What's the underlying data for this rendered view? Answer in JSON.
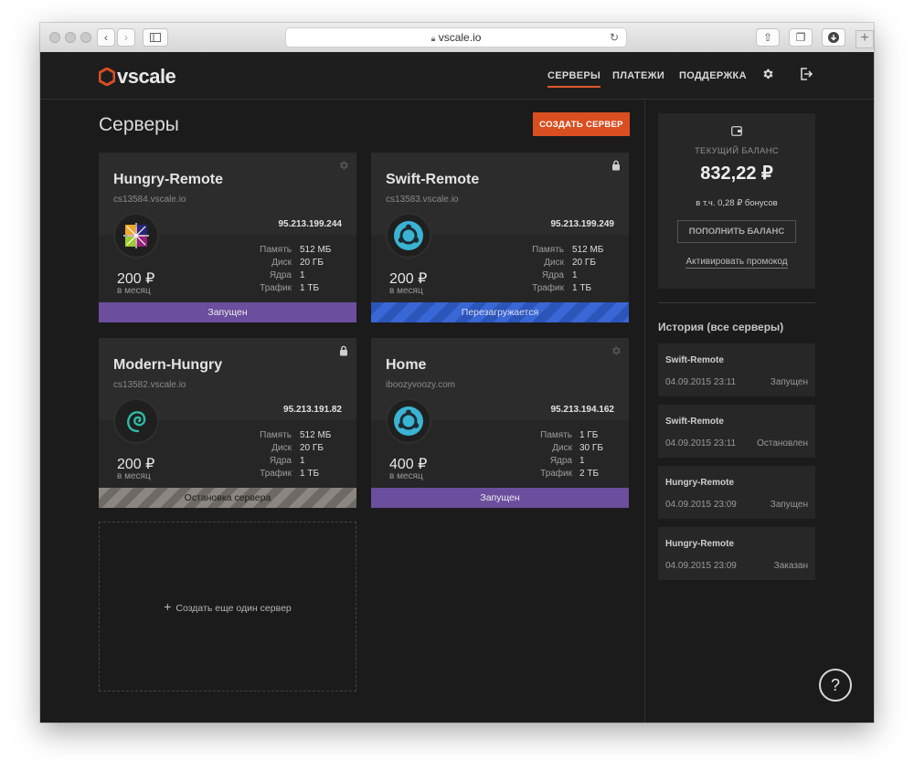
{
  "browser": {
    "url": "vscale.io"
  },
  "header": {
    "logo": "vscale",
    "nav": [
      {
        "label": "СЕРВЕРЫ"
      },
      {
        "label": "ПЛАТЕЖИ"
      },
      {
        "label": "ПОДДЕРЖКА"
      }
    ]
  },
  "main": {
    "title": "Серверы",
    "create_label": "СОЗДАТЬ СЕРВЕР",
    "new_server_label": "Создать еще один сервер",
    "spec_labels": {
      "memory": "Память",
      "disk": "Диск",
      "cores": "Ядра",
      "traffic": "Трафик"
    },
    "per_month": "в месяц",
    "servers": [
      {
        "name": "Hungry-Remote",
        "host": "cs13584.vscale.io",
        "ip": "95.213.199.244",
        "os": "centos-icon",
        "price": "200 ₽",
        "memory": "512 МБ",
        "disk": "20 ГБ",
        "cores": "1",
        "traffic": "1 ТБ",
        "status": "Запущен",
        "corner_icon": "gear-icon"
      },
      {
        "name": "Swift-Remote",
        "host": "cs13583.vscale.io",
        "ip": "95.213.199.249",
        "os": "ubuntu-icon",
        "price": "200 ₽",
        "memory": "512 МБ",
        "disk": "20 ГБ",
        "cores": "1",
        "traffic": "1 ТБ",
        "status": "Перезагружается",
        "corner_icon": "lock-icon"
      },
      {
        "name": "Modern-Hungry",
        "host": "cs13582.vscale.io",
        "ip": "95.213.191.82",
        "os": "debian-icon",
        "price": "200 ₽",
        "memory": "512 МБ",
        "disk": "20 ГБ",
        "cores": "1",
        "traffic": "1 ТБ",
        "status": "Остановка сервера",
        "corner_icon": "lock-icon"
      },
      {
        "name": "Home",
        "host": "iboozyvoozy.com",
        "ip": "95.213.194.162",
        "os": "ubuntu-icon",
        "price": "400 ₽",
        "memory": "1 ГБ",
        "disk": "30 ГБ",
        "cores": "1",
        "traffic": "2 ТБ",
        "status": "Запущен",
        "corner_icon": "gear-icon"
      }
    ]
  },
  "sidebar": {
    "balance_label": "ТЕКУЩИЙ БАЛАНС",
    "balance": "832,22 ₽",
    "bonus": "в т.ч. 0,28 ₽ бонусов",
    "topup_label": "ПОПОЛНИТЬ БАЛАНС",
    "promo_label": "Активировать промокод",
    "history_title": "История (все серверы)",
    "history": [
      {
        "server": "Swift-Remote",
        "date": "04.09.2015 23:11",
        "status": "Запущен"
      },
      {
        "server": "Swift-Remote",
        "date": "04.09.2015 23:11",
        "status": "Остановлен"
      },
      {
        "server": "Hungry-Remote",
        "date": "04.09.2015 23:09",
        "status": "Запущен"
      },
      {
        "server": "Hungry-Remote",
        "date": "04.09.2015 23:09",
        "status": "Заказан"
      }
    ]
  },
  "help_label": "?",
  "colors": {
    "accent": "#d94f22",
    "running": "#6b4e9e",
    "rebooting": "#2b55b9",
    "stopping": "#8b8680",
    "background": "#1b1b1b"
  }
}
